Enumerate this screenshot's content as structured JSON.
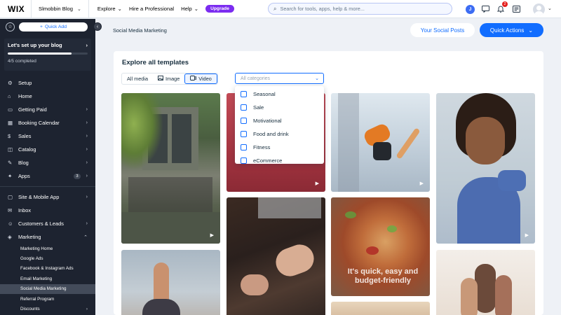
{
  "topbar": {
    "logo": "WIX",
    "site_name": "Slmobbin Blog",
    "nav": [
      {
        "label": "Explore",
        "chevron": true
      },
      {
        "label": "Hire a Professional",
        "chevron": false
      },
      {
        "label": "Help",
        "chevron": true
      }
    ],
    "upgrade_label": "Upgrade",
    "search_placeholder": "Search for tools, apps, help & more...",
    "account_initial": "J",
    "notifications_count": "2"
  },
  "sidebar": {
    "quick_add_label": "Quick Add",
    "setup": {
      "title": "Let's set up your blog",
      "progress_text": "4/5 completed",
      "progress_fraction": 0.8
    },
    "items": [
      {
        "label": "Setup",
        "icon": "wrench-icon",
        "glyph": "⚙",
        "arrow": false
      },
      {
        "label": "Home",
        "icon": "home-icon",
        "glyph": "⌂",
        "arrow": false
      },
      {
        "label": "Getting Paid",
        "icon": "wallet-icon",
        "glyph": "▭",
        "arrow": true
      },
      {
        "label": "Booking Calendar",
        "icon": "calendar-icon",
        "glyph": "▦",
        "arrow": true
      },
      {
        "label": "Sales",
        "icon": "sales-icon",
        "glyph": "$",
        "arrow": true
      },
      {
        "label": "Catalog",
        "icon": "catalog-icon",
        "glyph": "◫",
        "arrow": true
      },
      {
        "label": "Blog",
        "icon": "blog-icon",
        "glyph": "✎",
        "arrow": true
      },
      {
        "label": "Apps",
        "icon": "apps-icon",
        "glyph": "✦",
        "arrow": true,
        "badge": "3"
      }
    ],
    "items2": [
      {
        "label": "Site & Mobile App",
        "icon": "site-icon",
        "glyph": "▢",
        "arrow": true
      },
      {
        "label": "Inbox",
        "icon": "inbox-icon",
        "glyph": "✉",
        "arrow": false
      },
      {
        "label": "Customers & Leads",
        "icon": "customers-icon",
        "glyph": "☺",
        "arrow": true
      },
      {
        "label": "Marketing",
        "icon": "marketing-icon",
        "glyph": "◈",
        "arrow": "up"
      }
    ],
    "marketing_sub": [
      {
        "label": "Marketing Home",
        "active": false,
        "arrow": false
      },
      {
        "label": "Google Ads",
        "active": false,
        "arrow": false
      },
      {
        "label": "Facebook & Instagram Ads",
        "active": false,
        "arrow": false
      },
      {
        "label": "Email Marketing",
        "active": false,
        "arrow": false
      },
      {
        "label": "Social Media Marketing",
        "active": true,
        "arrow": false
      },
      {
        "label": "Referral Program",
        "active": false,
        "arrow": false
      },
      {
        "label": "Discounts",
        "active": false,
        "arrow": true
      }
    ]
  },
  "header": {
    "breadcrumb": "Social Media Marketing",
    "social_posts_label": "Your Social Posts",
    "quick_actions_label": "Quick Actions"
  },
  "main": {
    "title": "Explore all templates",
    "media_tabs": [
      {
        "label": "All media",
        "icon": "",
        "selected": false
      },
      {
        "label": "Image",
        "icon": "image-icon",
        "selected": false
      },
      {
        "label": "Video",
        "icon": "video-icon",
        "selected": true
      }
    ],
    "category_placeholder": "All categories",
    "categories": [
      "Seasonal",
      "Sale",
      "Motivational",
      "Food and drink",
      "Fitness",
      "eCommerce"
    ],
    "tile_overlay_text": "It's quick, easy and budget-friendly"
  },
  "colors": {
    "accent": "#116dff",
    "sidebar_bg": "#1d2330",
    "upgrade": "#7b2cf0"
  }
}
